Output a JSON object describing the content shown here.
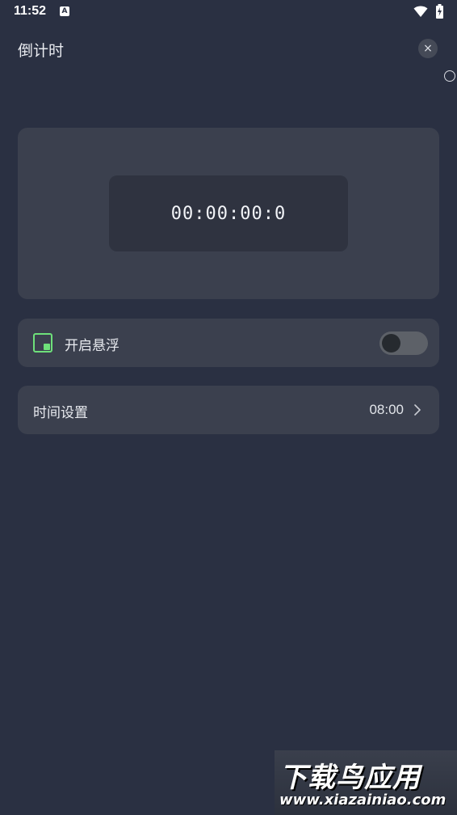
{
  "status_bar": {
    "time": "11:52",
    "notification_icon": "A"
  },
  "header": {
    "title": "倒计时",
    "close_label": "×"
  },
  "timer": {
    "display": "00:00:00:0"
  },
  "float_row": {
    "label": "开启悬浮",
    "icon": "picture-in-picture-icon",
    "toggle_on": false
  },
  "time_row": {
    "label": "时间设置",
    "value": "08:00"
  },
  "watermark": {
    "title": "下载鸟应用",
    "url": "www.xiazainiao.com"
  },
  "colors": {
    "background": "#2a3042",
    "card": "#3b404e",
    "timer_inner": "#2f3340",
    "accent_green": "#6ee07a",
    "toggle_track": "#5d6168"
  }
}
